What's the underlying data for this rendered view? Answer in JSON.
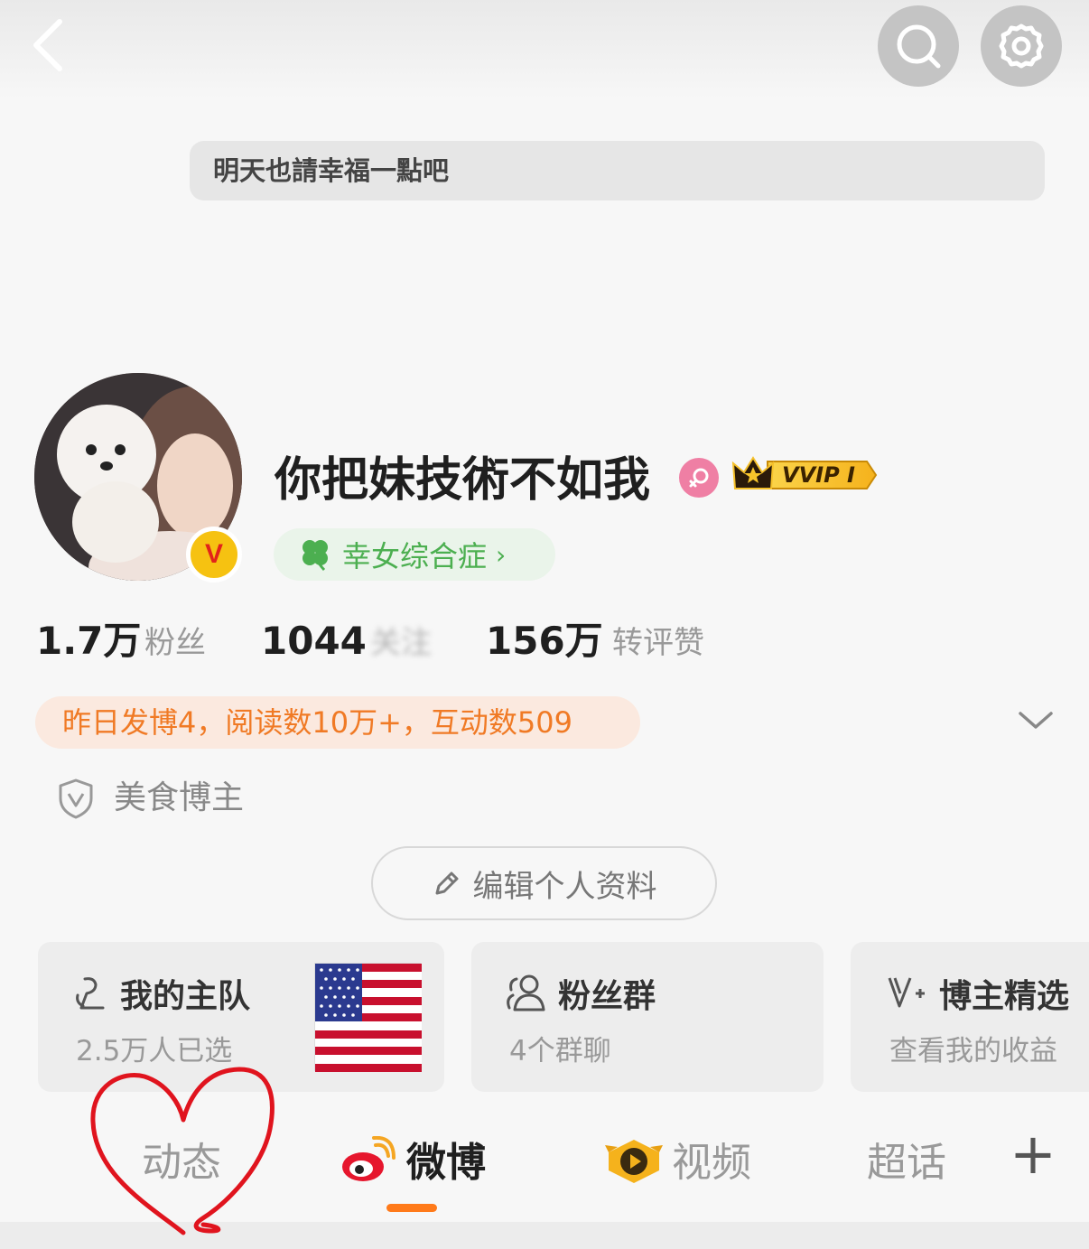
{
  "motto": "明天也請幸福一點吧",
  "profile": {
    "username": "你把妹技術不如我",
    "vip_badge": "VVIP I",
    "tag": "幸女综合症",
    "tag_chevron": "›",
    "verified_badge": "V"
  },
  "stats": [
    {
      "value": "1.7万",
      "label": "粉丝"
    },
    {
      "value": "1044",
      "label": "关注"
    },
    {
      "value": "156万",
      "label": "转评赞"
    }
  ],
  "summary": "昨日发博4，阅读数10万+，互动数509",
  "certification": "美食博主",
  "edit_button": "编辑个人资料",
  "cards": [
    {
      "title": "我的主队",
      "subtitle": "2.5万人已选"
    },
    {
      "title": "粉丝群",
      "subtitle": "4个群聊"
    },
    {
      "title": "博主精选",
      "subtitle": "查看我的收益"
    }
  ],
  "tabs": [
    {
      "label": "动态"
    },
    {
      "label": "微博",
      "active": true
    },
    {
      "label": "视频"
    },
    {
      "label": "超话"
    }
  ],
  "tab_add": "+",
  "colors": {
    "accent": "#ff7a1a",
    "summary_text": "#f07a25",
    "tag_green": "#4caf50",
    "annotation_red": "#e0141e"
  },
  "icons": [
    "back-icon",
    "search-icon",
    "gear-icon",
    "female-icon",
    "crown-icon",
    "clover-icon",
    "shield-v-icon",
    "pencil-icon",
    "team-icon",
    "group-icon",
    "v-plus-icon",
    "weibo-logo-icon",
    "video-icon"
  ]
}
